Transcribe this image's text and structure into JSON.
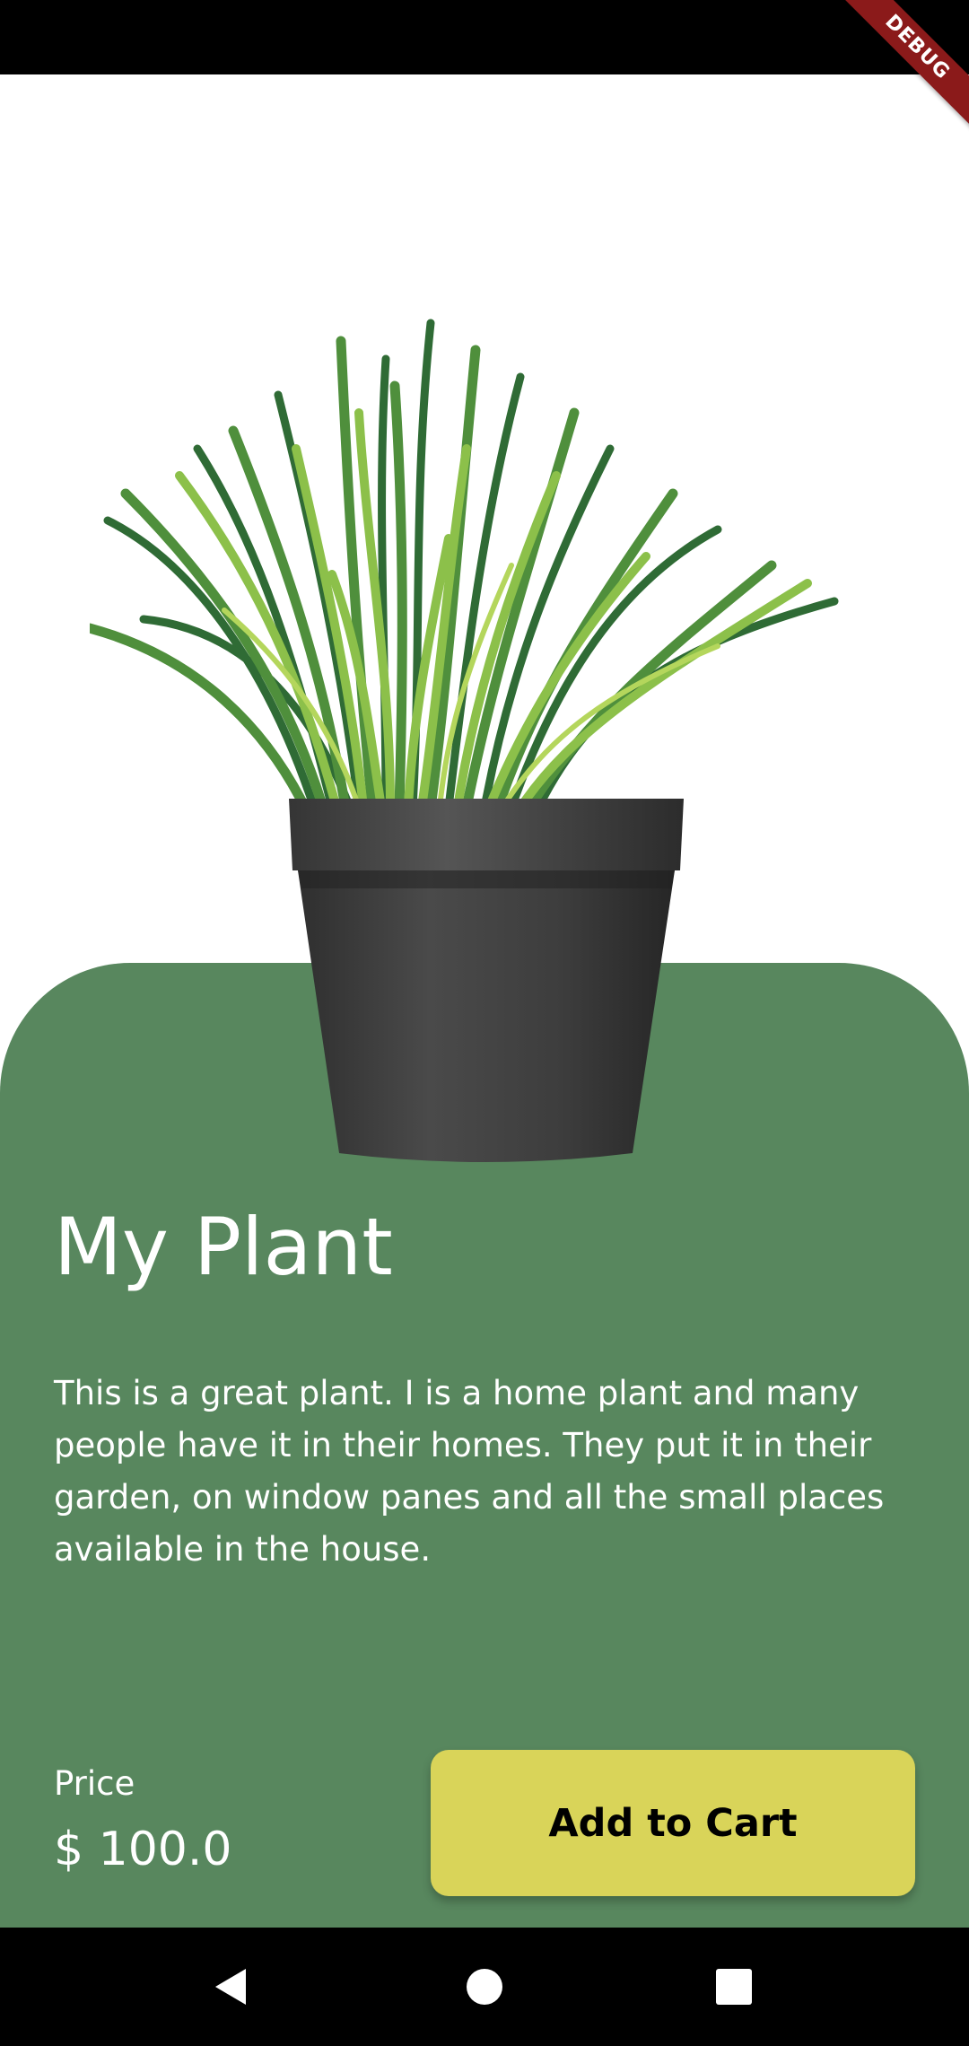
{
  "debug_banner": {
    "label": "DEBUG"
  },
  "plant": {
    "name": "My Plant",
    "description": "This is a great plant. I is a home plant and many people have it in their homes. They put it in their garden, on window panes and all the small places available in the house.",
    "image_icon": "potted-grass-plant"
  },
  "price": {
    "label": "Price",
    "value": "$ 100.0"
  },
  "actions": {
    "add_to_cart_label": "Add to Cart"
  },
  "navigation": {
    "back_icon": "triangle-back-icon",
    "home_icon": "circle-home-icon",
    "recents_icon": "square-recents-icon"
  },
  "colors": {
    "panel_green": "#58875e",
    "button_yellow": "#d9d459",
    "debug_red": "#8b1a1a"
  }
}
